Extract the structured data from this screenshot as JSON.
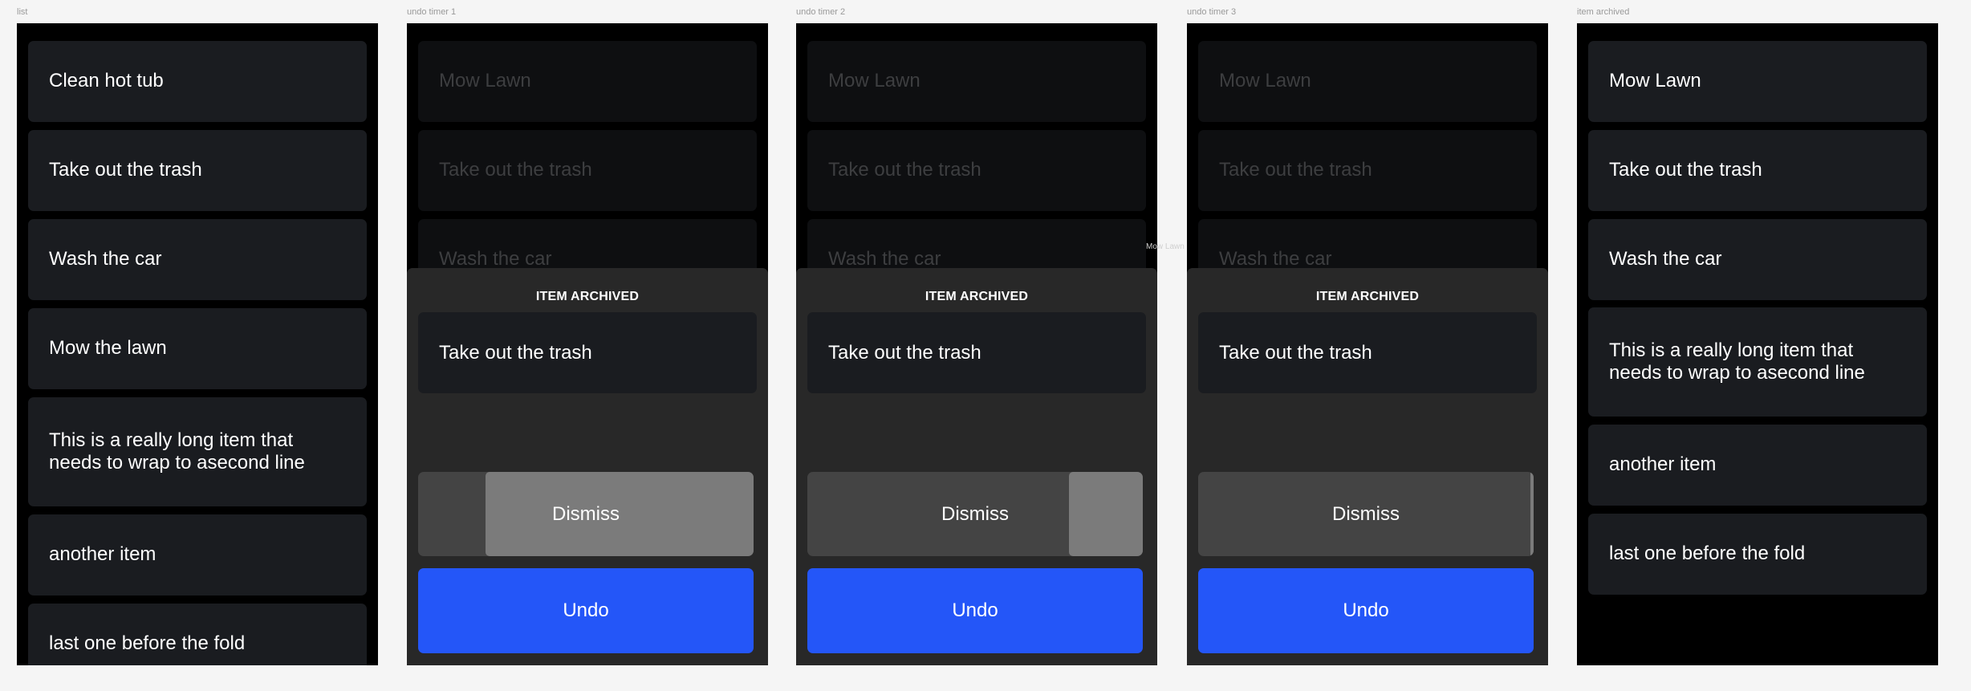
{
  "frames": [
    {
      "label": "list"
    },
    {
      "label": "undo timer 1"
    },
    {
      "label": "undo timer 2"
    },
    {
      "label": "undo timer 3"
    },
    {
      "label": "item archived"
    }
  ],
  "list": {
    "items": [
      "Clean hot tub",
      "Take out the trash",
      "Wash the car",
      "Mow the lawn",
      "This is a really long item that needs to wrap to asecond line",
      "another item",
      "last one before the fold"
    ]
  },
  "dimmed": {
    "items": [
      "Mow Lawn",
      "Take out the trash",
      "Wash the car"
    ]
  },
  "sheet": {
    "title": "ITEM ARCHIVED",
    "item": "Take out the trash",
    "dismiss_label": "Dismiss",
    "undo_label": "Undo"
  },
  "timers": [
    {
      "remaining_fraction": 0.8
    },
    {
      "remaining_fraction": 0.22
    },
    {
      "remaining_fraction": 0.01
    }
  ],
  "stray_text": "Mow Lawn",
  "archived": {
    "items": [
      "Mow Lawn",
      "Take out the trash",
      "Wash the car",
      "This is a really long item that needs to wrap to asecond line",
      "another item",
      "last one before the fold"
    ]
  },
  "colors": {
    "background": "#f5f5f5",
    "frame": "#000000",
    "card": "#1a1c20",
    "sheet": "#282828",
    "dismiss": "#444444",
    "dismiss_fill": "#7b7b7b",
    "undo": "#2456f8"
  }
}
